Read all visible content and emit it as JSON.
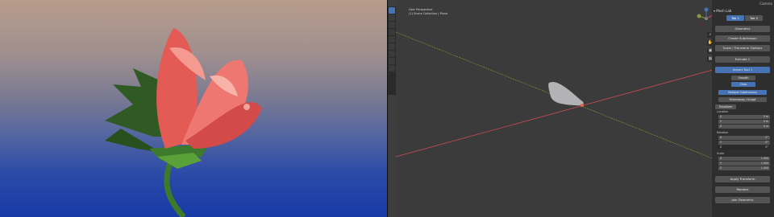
{
  "window": {
    "title": "Camera"
  },
  "viewport": {
    "title": "User Perspective",
    "collection": "(1) Scene Collection | Plane"
  },
  "sidebar": {
    "addon_title": "Mesh Lab",
    "tabs": [
      "Tab 1",
      "Tab 2"
    ],
    "buttons": [
      "Geometry",
      "Create Subdivision",
      "Scale / Transform Options",
      "Extrude 1",
      "Import Tool 1"
    ],
    "sub_buttons": [
      "Smooth",
      "Clear",
      "Multiple Subdivisions",
      "Shrinkwrap / Sculpt"
    ],
    "transform_label": "Transform",
    "location_label": "Location",
    "rotation_label": "Rotation",
    "scale_label": "Scale",
    "location": [
      {
        "axis": "X",
        "value": "0 m"
      },
      {
        "axis": "Y",
        "value": "0 m"
      },
      {
        "axis": "Z",
        "value": "0 m"
      }
    ],
    "rotation": [
      {
        "axis": "X",
        "value": "0°"
      },
      {
        "axis": "Y",
        "value": "0°"
      },
      {
        "axis": "Z",
        "value": "0°"
      }
    ],
    "scale": [
      {
        "axis": "X",
        "value": "1.000"
      },
      {
        "axis": "Y",
        "value": "1.000"
      },
      {
        "axis": "Z",
        "value": "1.000"
      }
    ],
    "bottom_buttons": [
      "Apply Transform",
      "Replace",
      "Join Geometry"
    ]
  },
  "colors": {
    "accent": "#4772b3",
    "x_axis": "#c94a55",
    "y_axis": "#8a9a3a",
    "cursor": "#d4c43a"
  }
}
